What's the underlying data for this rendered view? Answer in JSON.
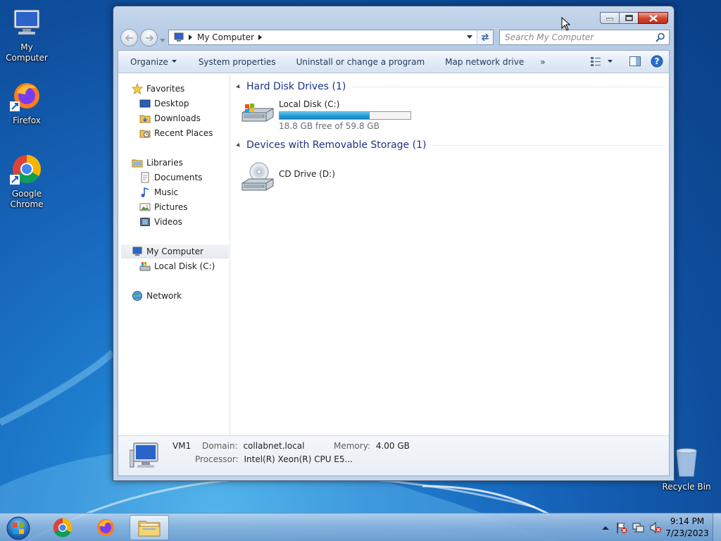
{
  "desktop": {
    "icons": [
      {
        "label": "My Computer"
      },
      {
        "label": "Firefox"
      },
      {
        "label": "Google Chrome"
      },
      {
        "label": "Recycle Bin"
      }
    ]
  },
  "window": {
    "address": {
      "crumb": "My Computer"
    },
    "search": {
      "placeholder": "Search My Computer"
    },
    "toolbar": {
      "organize": "Organize",
      "system_properties": "System properties",
      "uninstall": "Uninstall or change a program",
      "map_drive": "Map network drive",
      "more": "»"
    },
    "nav": {
      "favorites": "Favorites",
      "desktop": "Desktop",
      "downloads": "Downloads",
      "recent_places": "Recent Places",
      "libraries": "Libraries",
      "documents": "Documents",
      "music": "Music",
      "pictures": "Pictures",
      "videos": "Videos",
      "my_computer": "My Computer",
      "local_disk": "Local Disk (C:)",
      "network": "Network"
    },
    "groups": {
      "hard_disks": "Hard Disk Drives (1)",
      "removable": "Devices with Removable Storage (1)"
    },
    "drives": {
      "c": {
        "name": "Local Disk (C:)",
        "free": "18.8 GB free of 59.8 GB",
        "used_fraction": 0.686
      },
      "d": {
        "name": "CD Drive (D:)"
      }
    },
    "details": {
      "computer_name": "VM1",
      "domain_label": "Domain:",
      "domain_value": "collabnet.local",
      "memory_label": "Memory:",
      "memory_value": "4.00 GB",
      "processor_label": "Processor:",
      "processor_value": "Intel(R) Xeon(R) CPU E5..."
    }
  },
  "taskbar": {
    "clock_time": "9:14 PM",
    "clock_date": "7/23/2023"
  },
  "colors": {
    "accent_title": "#1e3287",
    "progress": "#2aa2da",
    "close_button": "#d2432c"
  }
}
